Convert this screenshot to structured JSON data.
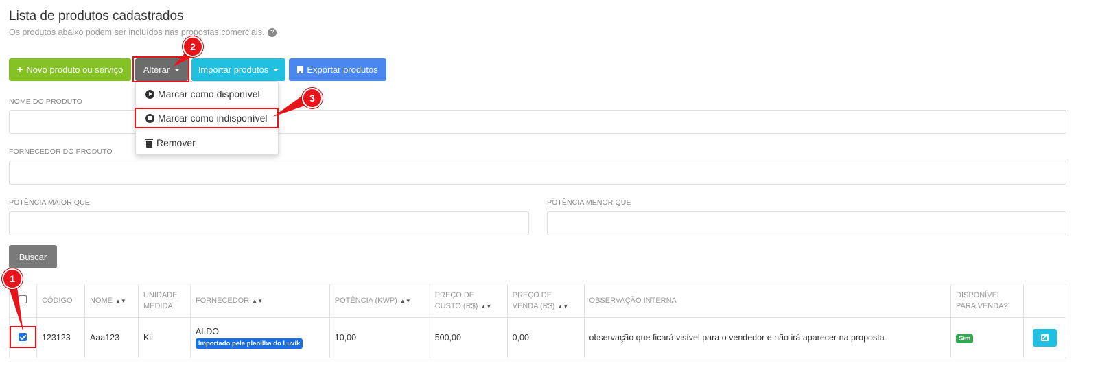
{
  "header": {
    "title": "Lista de produtos cadastrados",
    "subtitle": "Os produtos abaixo podem ser incluídos nas propostas comerciais."
  },
  "toolbar": {
    "new_label": "Novo produto ou serviço",
    "change_label": "Alterar",
    "import_label": "Importar produtos",
    "export_label": "Exportar produtos"
  },
  "change_menu": {
    "items": [
      {
        "label": "Marcar como disponível",
        "icon": "play-circle-icon"
      },
      {
        "label": "Marcar como indisponível",
        "icon": "pause-circle-icon"
      },
      {
        "label": "Remover",
        "icon": "trash-icon"
      }
    ]
  },
  "filters": {
    "product_name_label": "NOME DO PRODUTO",
    "supplier_label": "FORNECEDOR DO PRODUTO",
    "power_greater_label": "POTÊNCIA MAIOR QUE",
    "power_less_label": "POTÊNCIA MENOR QUE",
    "product_name_value": "",
    "supplier_value": "",
    "power_greater_value": "",
    "power_less_value": "",
    "search_label": "Buscar"
  },
  "table": {
    "columns": [
      "CÓDIGO",
      "NOME",
      "UNIDADE MEDIDA",
      "FORNECEDOR",
      "POTÊNCIA (KWP)",
      "PREÇO DE CUSTO (R$)",
      "PREÇO DE VENDA (R$)",
      "OBSERVAÇÃO INTERNA",
      "DISPONÍVEL PARA VENDA?"
    ],
    "rows": [
      {
        "checked": true,
        "code": "123123",
        "name": "Aaa123",
        "unit": "Kit",
        "supplier": "ALDO",
        "supplier_badge": "Importado pela planilha do Luvik",
        "power": "10,00",
        "cost_price": "500,00",
        "sale_price": "0,00",
        "note": "observação que ficará visível para o vendedor e não irá aparecer na proposta",
        "available": "Sim"
      }
    ]
  },
  "annotations": {
    "markers": [
      "1",
      "2",
      "3"
    ],
    "color": "#e8141b"
  },
  "colors": {
    "green": "#84c226",
    "gray": "#6c6c6c",
    "cyan": "#22c0e0",
    "blue": "#4a87ee",
    "badge_blue": "#1a6ee8",
    "badge_green": "#2fa84f"
  }
}
